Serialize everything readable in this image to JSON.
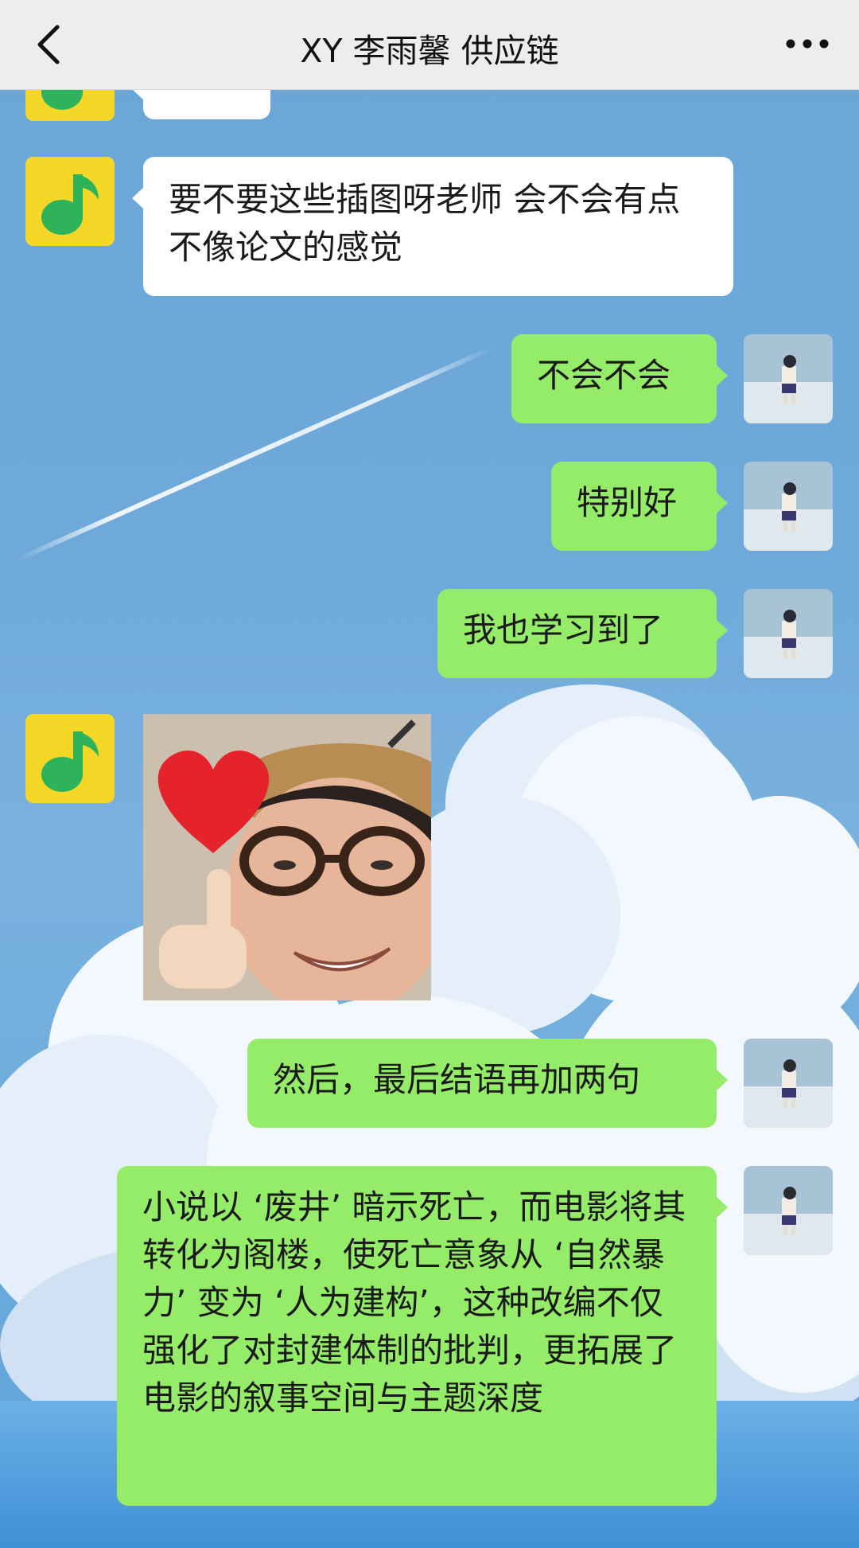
{
  "header": {
    "title": "XY 李雨馨 供应链",
    "back_icon": "chevron-left-icon",
    "more_icon": "more-dots-icon"
  },
  "colors": {
    "outgoing_bubble": "#95ec69",
    "incoming_bubble": "#ffffff",
    "header_bg": "#ededed"
  },
  "messages": [
    {
      "direction": "in",
      "type": "text",
      "text": "要不要这些插图呀老师 会不会有点不像论文的感觉"
    },
    {
      "direction": "out",
      "type": "text",
      "text": "不会不会"
    },
    {
      "direction": "out",
      "type": "text",
      "text": "特别好"
    },
    {
      "direction": "out",
      "type": "text",
      "text": "我也学习到了"
    },
    {
      "direction": "in",
      "type": "sticker",
      "icon": "heart-face-sticker"
    },
    {
      "direction": "out",
      "type": "text",
      "text": "然后，最后结语再加两句"
    },
    {
      "direction": "out",
      "type": "text",
      "text": "小说以 ‘废井’ 暗示死亡，而电影将其转化为阁楼，使死亡意象从 ‘自然暴力’ 变为 ‘人为建构’，这种改编不仅强化了对封建体制的批判，更拓展了电影的叙事空间与主题深度"
    }
  ]
}
